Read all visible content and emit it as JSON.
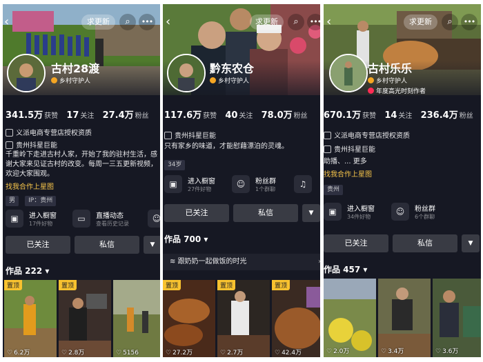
{
  "common": {
    "update_label": "求更新",
    "follow_label": "已关注",
    "message_label": "私信",
    "more_dropdown": "▼",
    "back_icon": "chevron-left-icon",
    "search_icon": "search-icon",
    "more_icon": "more-dots-icon",
    "followers_label": "粉丝",
    "following_label": "关注",
    "likes_label": "获赞",
    "pin_label": "置顶"
  },
  "profiles": [
    {
      "name": "古村28渡",
      "badge": "乡村守护人",
      "stats": {
        "likes": "341.5万",
        "following": "17",
        "followers": "27.4万"
      },
      "line1": "义派电商专营店授权资质",
      "line2": "贵州抖星巨能",
      "bio": "千重岭下走进古村人家，开始了我的驻村生活，感谢大家来见证古村的改变。每周一三五更新视频，欢迎大家围观。",
      "link": "找我合作上星图",
      "chips": [
        "男",
        "IP：贵州"
      ],
      "features": [
        {
          "title": "进入橱窗",
          "sub": "17件好物"
        },
        {
          "title": "直播动态",
          "sub": "查看历史记录"
        }
      ],
      "works": "作品 222 ▾",
      "thumbs": [
        {
          "pin": "置顶",
          "likes": "6.2万"
        },
        {
          "pin": "置顶",
          "likes": "2.8万"
        },
        {
          "pin": "",
          "likes": "5156"
        }
      ]
    },
    {
      "name": "黔东农仓",
      "badge": "乡村守护人",
      "stats": {
        "likes": "117.6万",
        "following": "40",
        "followers": "78.0万"
      },
      "line1": "贵州抖星巨能",
      "bio": "只有家乡的味道，才能慰藉漂泊的灵魂。",
      "chips": [
        "34岁"
      ],
      "features": [
        {
          "title": "进入橱窗",
          "sub": "27件好物"
        },
        {
          "title": "粉丝群",
          "sub": "1个群聊"
        }
      ],
      "works": "作品 700 ▾",
      "collection": "跟奶奶一起做饭的时光",
      "thumbs": [
        {
          "pin": "置顶",
          "likes": "27.2万"
        },
        {
          "pin": "置顶",
          "likes": "2.7万"
        },
        {
          "pin": "置顶",
          "likes": "42.4万"
        }
      ]
    },
    {
      "name": "古村乐乐",
      "badge": "乡村守护人",
      "badge2": "年度高光时刻作者",
      "stats": {
        "likes": "670.1万",
        "following": "14",
        "followers": "236.4万"
      },
      "line1": "义派电商专营店授权资质",
      "line2": "贵州抖星巨能",
      "bio": "助播、... 更多",
      "link": "找我合作上星图",
      "chips": [
        "贵州"
      ],
      "features": [
        {
          "title": "进入橱窗",
          "sub": "34件好物"
        },
        {
          "title": "粉丝群",
          "sub": "6个群聊"
        }
      ],
      "works": "作品 457 ▾",
      "thumbs": [
        {
          "pin": "",
          "likes": "2.0万"
        },
        {
          "pin": "",
          "likes": "3.4万"
        },
        {
          "pin": "",
          "likes": "3.6万"
        }
      ]
    }
  ]
}
